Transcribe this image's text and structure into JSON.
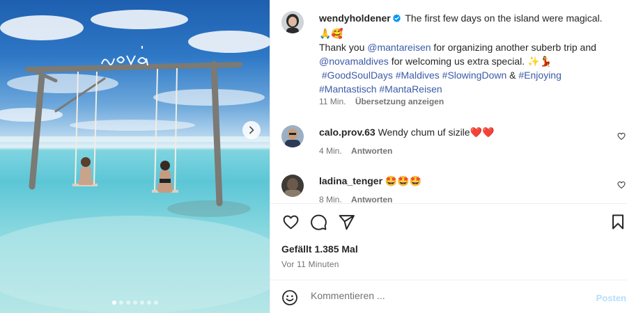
{
  "post": {
    "carousel": {
      "slide_count": 7,
      "active_index": 0
    },
    "photo_overlay_text": "nova"
  },
  "caption": {
    "username": "wendyholdener",
    "line1": "The first few days on the island were magical.",
    "emoji1": "🙏🥰",
    "thank": "Thank you",
    "mention1": "@mantareisen",
    "thank_rest": "for organizing another suberb trip and",
    "mention2": "@novamaldives",
    "welcome": "for welcoming us extra special.",
    "emoji2": "✨💃",
    "tags": [
      "#GoodSoulDays",
      "#Maldives",
      "#SlowingDown"
    ],
    "amp": "&",
    "tags2": [
      "#Enjoying",
      "#Mantastisch",
      "#MantaReisen"
    ],
    "time": "11 Min.",
    "translate": "Übersetzung anzeigen"
  },
  "comments": [
    {
      "username": "calo.prov.63",
      "text": "Wendy chum uf sizile",
      "emoji": "❤️❤️",
      "time": "4 Min.",
      "reply": "Antworten"
    },
    {
      "username": "ladina_tenger",
      "text": "",
      "emoji": "🤩🤩🤩",
      "time": "8 Min.",
      "reply": "Antworten"
    }
  ],
  "actions": {
    "likes": "Gefällt 1.385 Mal",
    "timestamp": "Vor 11 Minuten"
  },
  "composer": {
    "placeholder": "Kommentieren ...",
    "post_label": "Posten"
  },
  "colors": {
    "link": "#3b5aa8",
    "verified": "#0095f6",
    "heart": "#e3112c",
    "post_disabled": "#b2dffc"
  }
}
